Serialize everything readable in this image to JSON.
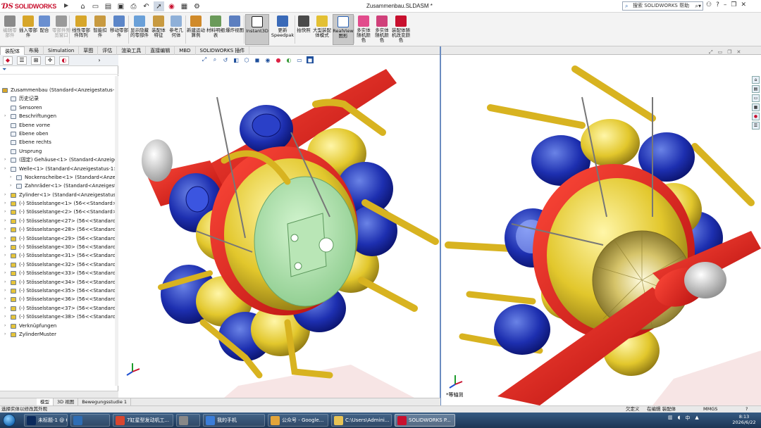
{
  "app": {
    "brand": "SOLIDWORKS",
    "doc_title": "Zusammenbau.SLDASM *",
    "search_placeholder": "搜索 SOLIDWORKS 帮助"
  },
  "commands": [
    {
      "label": "编辑零部件",
      "dim": true
    },
    {
      "label": "插入零部件"
    },
    {
      "label": "配合"
    },
    {
      "label": "零部件预览窗口",
      "dim": true
    },
    {
      "label": "线性零部件阵列"
    },
    {
      "label": "智能扣件"
    },
    {
      "label": "移动零部件"
    },
    {
      "label": "显示隐藏的零部件"
    },
    {
      "label": "装配体特征"
    },
    {
      "label": "参考几何体"
    },
    {
      "label": "新建运动算例"
    },
    {
      "label": "材料明细表"
    },
    {
      "label": "爆炸视图"
    },
    {
      "label": "Instant3D",
      "active": true
    },
    {
      "label": "更新Speedpak"
    },
    {
      "label": "拍快照"
    },
    {
      "label": "大型装配体模式"
    },
    {
      "label": "RealView图形",
      "active": true
    },
    {
      "label": "多实体随机颜色"
    },
    {
      "label": "多实体随机颜色"
    },
    {
      "label": "装配体随机改变颜色"
    }
  ],
  "tabs": [
    "装配体",
    "布局",
    "Simulation",
    "草图",
    "评估",
    "渲染工具",
    "直接编辑",
    "MBD",
    "SOLIDWORKS 插件"
  ],
  "tree": [
    {
      "label": "Zusammenbau  (Standard<Anzeigestatus-",
      "level": 0,
      "exp": ""
    },
    {
      "label": "历史记录",
      "level": 1,
      "exp": ""
    },
    {
      "label": "Sensoren",
      "level": 1,
      "exp": ""
    },
    {
      "label": "Beschriftungen",
      "level": 1,
      "exp": "›"
    },
    {
      "label": "Ebene vorne",
      "level": 1,
      "exp": ""
    },
    {
      "label": "Ebene oben",
      "level": 1,
      "exp": ""
    },
    {
      "label": "Ebene rechts",
      "level": 1,
      "exp": ""
    },
    {
      "label": "Ursprung",
      "level": 1,
      "exp": ""
    },
    {
      "label": "(固定) Gehäuse<1> (Standard<Anzeigestat",
      "level": 1,
      "exp": "›"
    },
    {
      "label": "Welle<1> (Standard<Anzeigestatus-1>)",
      "level": 1,
      "exp": "›"
    },
    {
      "label": "Nockenscheibe<1> (Standard<Anzeigest",
      "level": 2,
      "exp": "›"
    },
    {
      "label": "Zahnräder<1> (Standard<Anzeigestat",
      "level": 2,
      "exp": "›"
    },
    {
      "label": "Zylinder<1> (Standard<Anzeigestatus-1>)",
      "level": 1,
      "exp": "›"
    },
    {
      "label": "(-) Stösselstange<1> (56<<Standard>",
      "level": 1,
      "exp": "›"
    },
    {
      "label": "(-) Stösselstange<2> (56<<Standard>",
      "level": 1,
      "exp": "›"
    },
    {
      "label": "(-) Stösselstange<27> (56<<Standard",
      "level": 1,
      "exp": "›"
    },
    {
      "label": "(-) Stösselstange<28> (56<<Standard",
      "level": 1,
      "exp": "›"
    },
    {
      "label": "(-) Stösselstange<29> (56<<Standard",
      "level": 1,
      "exp": "›"
    },
    {
      "label": "(-) Stösselstange<30> (56<<Standard",
      "level": 1,
      "exp": "›"
    },
    {
      "label": "(-) Stösselstange<31> (56<<Standard",
      "level": 1,
      "exp": "›"
    },
    {
      "label": "(-) Stösselstange<32> (56<<Standard",
      "level": 1,
      "exp": "›"
    },
    {
      "label": "(-) Stösselstange<33> (56<<Standard",
      "level": 1,
      "exp": "›"
    },
    {
      "label": "(-) Stösselstange<34> (56<<Standard",
      "level": 1,
      "exp": "›"
    },
    {
      "label": "(-) Stösselstange<35> (56<<Standard",
      "level": 1,
      "exp": "›"
    },
    {
      "label": "(-) Stösselstange<36> (56<<Standard",
      "level": 1,
      "exp": "›"
    },
    {
      "label": "(-) Stösselstange<37> (56<<Standard",
      "level": 1,
      "exp": "›"
    },
    {
      "label": "(-) Stösselstange<38> (56<<Standard",
      "level": 1,
      "exp": "›"
    },
    {
      "label": "Verknüpfungen",
      "level": 1,
      "exp": "›"
    },
    {
      "label": "ZylinderMuster",
      "level": 1,
      "exp": "›"
    }
  ],
  "bottom_tabs": [
    "模型",
    "3D 视图",
    "Bewegungsstudie 1"
  ],
  "view_label": "*等轴测",
  "status": {
    "left": "选择实体以修改其外观",
    "s1": "欠定义",
    "s2": "在编辑 装配体",
    "units": "MMGS"
  },
  "taskbar": [
    {
      "label": "未标题-1 @ 66.7...",
      "color": "#0b2a5c"
    },
    {
      "label": "",
      "color": "#2e6db4"
    },
    {
      "label": "7缸星型发动机工...",
      "color": "#d8462f"
    },
    {
      "label": "",
      "color": "#888888"
    },
    {
      "label": "我的手机",
      "color": "#3b7dd8"
    },
    {
      "label": "公众号 - Google...",
      "color": "#e2a43a"
    },
    {
      "label": "C:\\Users\\Admini...",
      "color": "#e8c354"
    },
    {
      "label": "SOLIDWORKS P...",
      "color": "#c8102e"
    }
  ],
  "clock": {
    "time": "8:13",
    "date": "2026/6/22"
  },
  "colors": {
    "accent": "#c8102e",
    "taskbar": "#1f3a5c",
    "divider": "#6b8cc0"
  }
}
